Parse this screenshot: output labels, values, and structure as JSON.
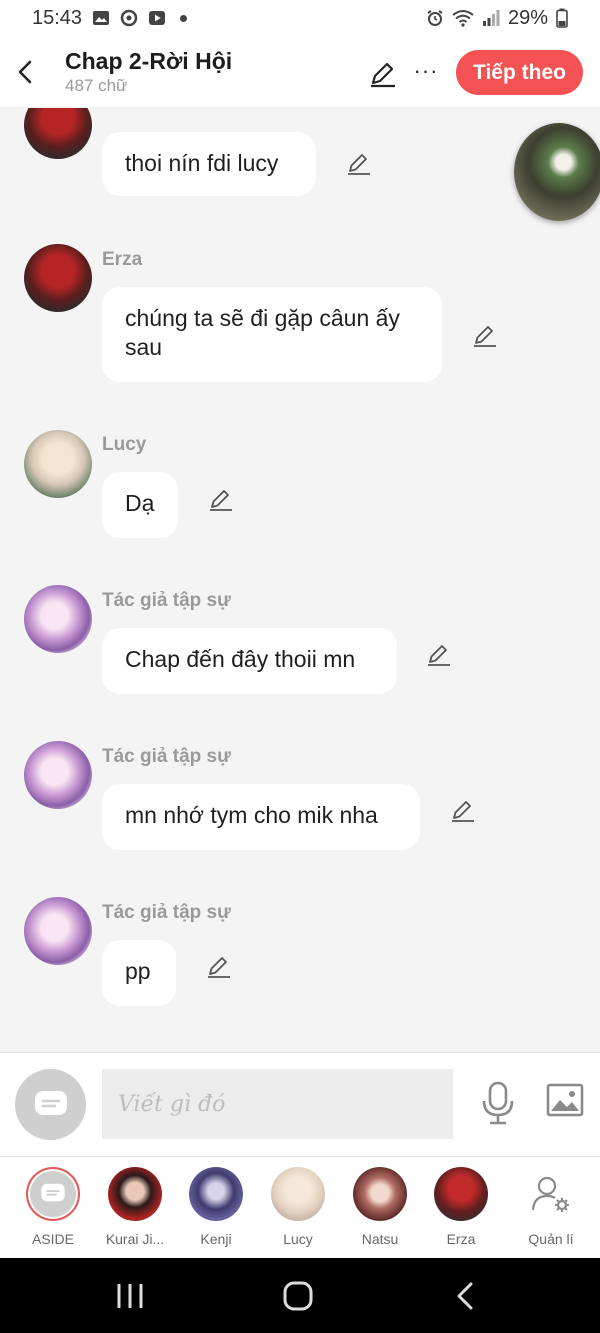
{
  "status_bar": {
    "time": "15:43",
    "battery": "29%"
  },
  "header": {
    "title": "Chap 2-Rời Hội",
    "word_count": "487 chữ",
    "next_label": "Tiếp theo",
    "more_label": "···"
  },
  "messages": [
    {
      "sender": "Erza",
      "text": "thoi nín fdi lucy"
    },
    {
      "sender": "Erza",
      "text": "chúng ta sẽ đi gặp câun ấy sau"
    },
    {
      "sender": "Lucy",
      "text": "Dạ"
    },
    {
      "sender": "Tác giả tập sự",
      "text": "Chap đến đây thoii mn"
    },
    {
      "sender": "Tác giả tập sự",
      "text": "mn nhớ tym cho mik nha"
    },
    {
      "sender": "Tác giả tập sự",
      "text": "pp"
    }
  ],
  "composer": {
    "placeholder": "Viết gì đó"
  },
  "characters": [
    {
      "name": "ASIDE"
    },
    {
      "name": "Kurai Ji..."
    },
    {
      "name": "Kenji"
    },
    {
      "name": "Lucy"
    },
    {
      "name": "Natsu"
    },
    {
      "name": "Erza"
    },
    {
      "name": "Quản lí"
    }
  ],
  "colors": {
    "accent": "#f55353",
    "background": "#f4f4f4"
  }
}
